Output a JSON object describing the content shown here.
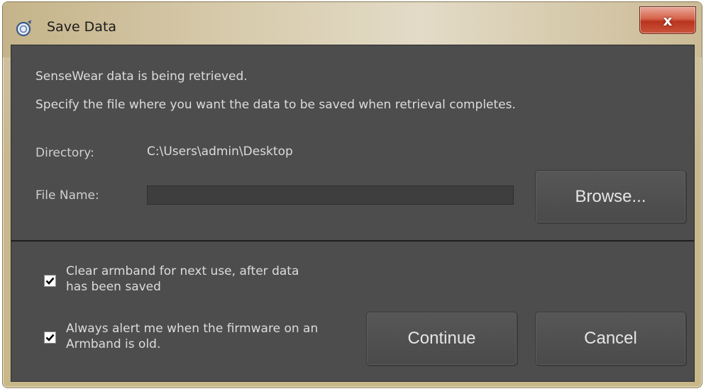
{
  "window": {
    "title": "Save Data",
    "close_label": "x"
  },
  "messages": {
    "line1": "SenseWear data is being retrieved.",
    "line2": "Specify the file where you want the data to be saved when retrieval completes."
  },
  "directory": {
    "label": "Directory:",
    "value": "C:\\Users\\admin\\Desktop"
  },
  "file_name": {
    "label": "File Name:",
    "value": "",
    "placeholder": ""
  },
  "buttons": {
    "browse": "Browse...",
    "continue": "Continue",
    "cancel": "Cancel"
  },
  "options": {
    "clear_armband": {
      "line1": "Clear armband for next use, after data",
      "line2": "has been saved",
      "checked": true
    },
    "firmware_alert": {
      "line1": "Always alert me when the firmware on an",
      "line2": "Armband is old.",
      "checked": true
    }
  },
  "colors": {
    "client_bg": "#4d4d4d",
    "frame": "#c7b891",
    "close_button": "#c9553c"
  }
}
